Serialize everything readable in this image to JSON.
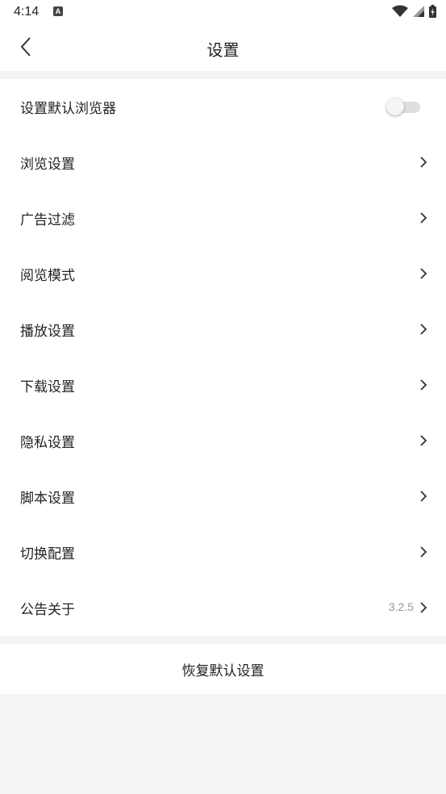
{
  "status_bar": {
    "time": "4:14",
    "notification_icon": "A",
    "icons": [
      "wifi-icon",
      "signal-icon",
      "battery-icon"
    ]
  },
  "header": {
    "title": "设置",
    "back_icon": "chevron-left-icon"
  },
  "settings": {
    "default_browser": {
      "label": "设置默认浏览器",
      "enabled": false
    },
    "items": [
      {
        "label": "浏览设置"
      },
      {
        "label": "广告过滤"
      },
      {
        "label": "阅览模式"
      },
      {
        "label": "播放设置"
      },
      {
        "label": "下载设置"
      },
      {
        "label": "隐私设置"
      },
      {
        "label": "脚本设置"
      },
      {
        "label": "切换配置"
      }
    ],
    "about": {
      "label": "公告关于",
      "version": "3.2.5"
    }
  },
  "reset": {
    "label": "恢复默认设置"
  },
  "colors": {
    "background": "#f4f4f4",
    "surface": "#ffffff",
    "text": "#222222",
    "secondary_text": "#999999"
  }
}
